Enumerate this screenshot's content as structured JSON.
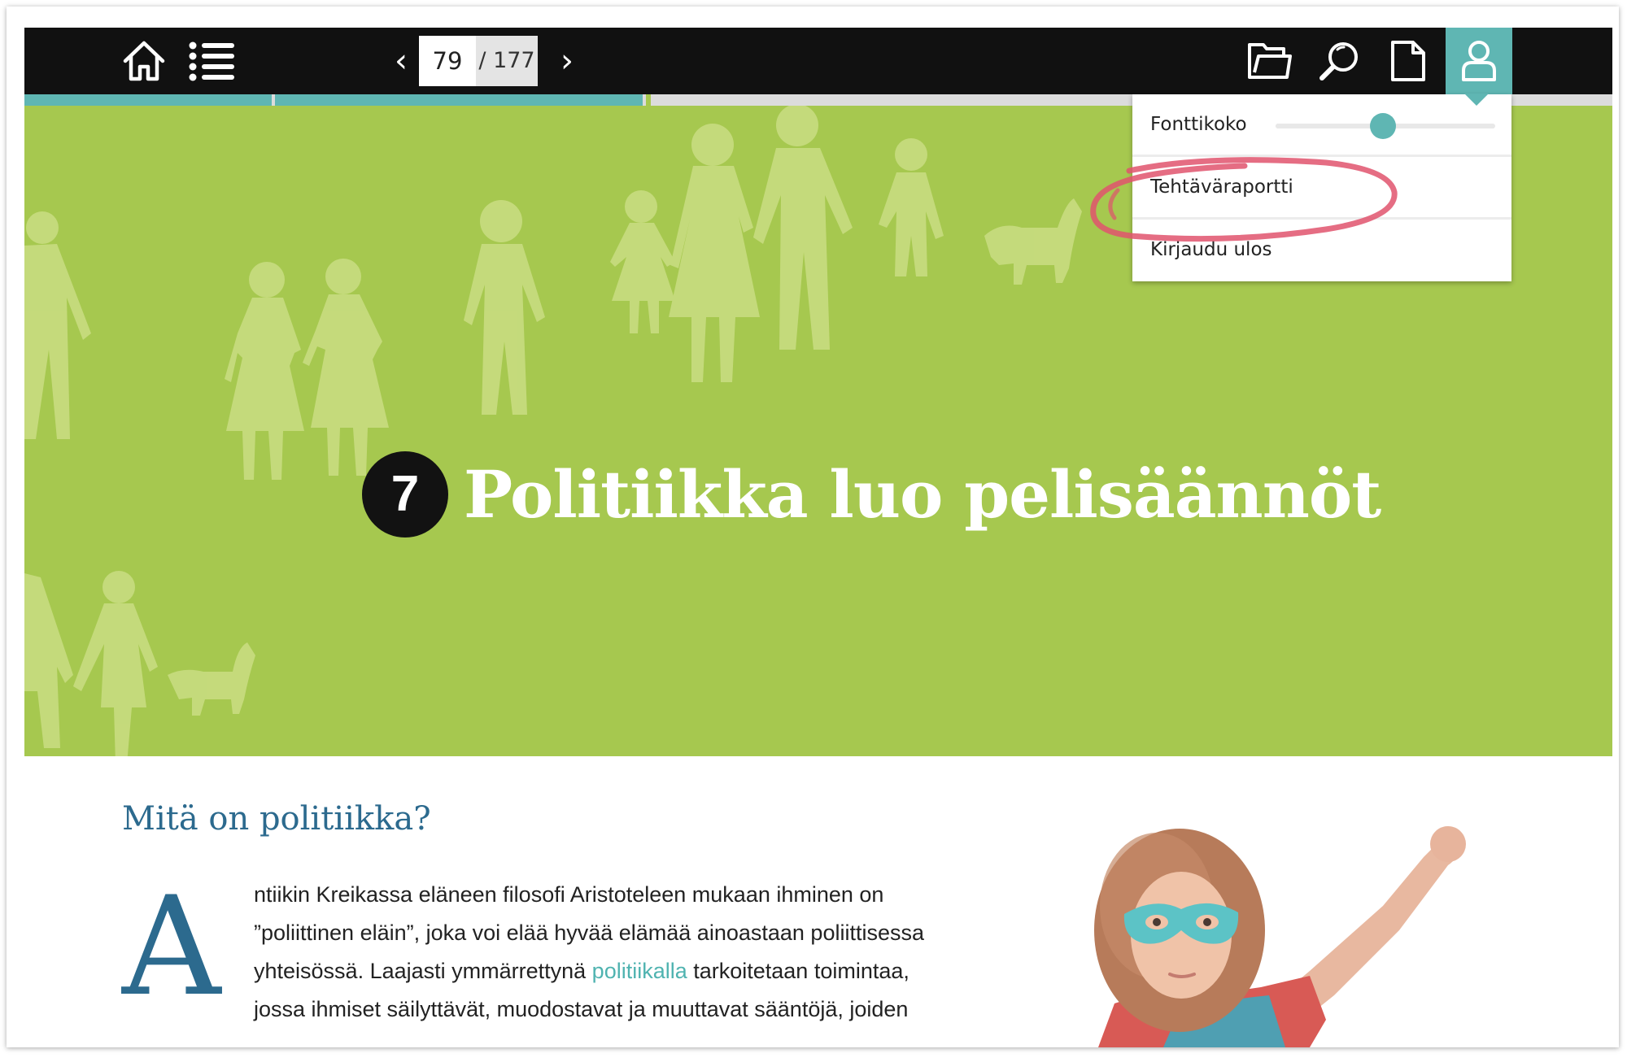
{
  "toolbar": {
    "home_icon": "home-icon",
    "toc_icon": "list-icon",
    "prev_page": "‹",
    "next_page": "›",
    "current_page": "79",
    "total_pages": "/ 177",
    "folder_icon": "folder-icon",
    "search_icon": "search-icon",
    "document_icon": "document-icon",
    "user_icon": "user-icon"
  },
  "user_menu": {
    "font_size_label": "Fonttikoko",
    "font_size_level": 0.49,
    "task_report_label": "Tehtäväraportti",
    "logout_label": "Kirjaudu ulos"
  },
  "hero": {
    "chapter_number": "7",
    "chapter_title": "Politiikka luo pelisäännöt"
  },
  "article": {
    "heading": "Mitä on politiikka?",
    "drop_cap": "A",
    "line1": "ntiikin Kreikassa eläneen filosofi Aristoteleen mukaan ihminen on",
    "line2": "”poliittinen eläin”, joka voi elää hyvää elämää ainoastaan poliittisessa",
    "line3_before": "yhteisössä. Laajasti ymmärrettynä ",
    "line3_link": "politiikalla",
    "line3_after": " tarkoitetaan toimintaa,",
    "line4": "jossa ihmiset säilyttävät, muodostavat ja muuttavat sääntöjä, joiden"
  },
  "colors": {
    "accent": "#5fb6b3",
    "hero_green": "#a6c84f",
    "heading_blue": "#2c6a8e",
    "highlight_red": "#e0536d",
    "toolbar_black": "#111111"
  }
}
